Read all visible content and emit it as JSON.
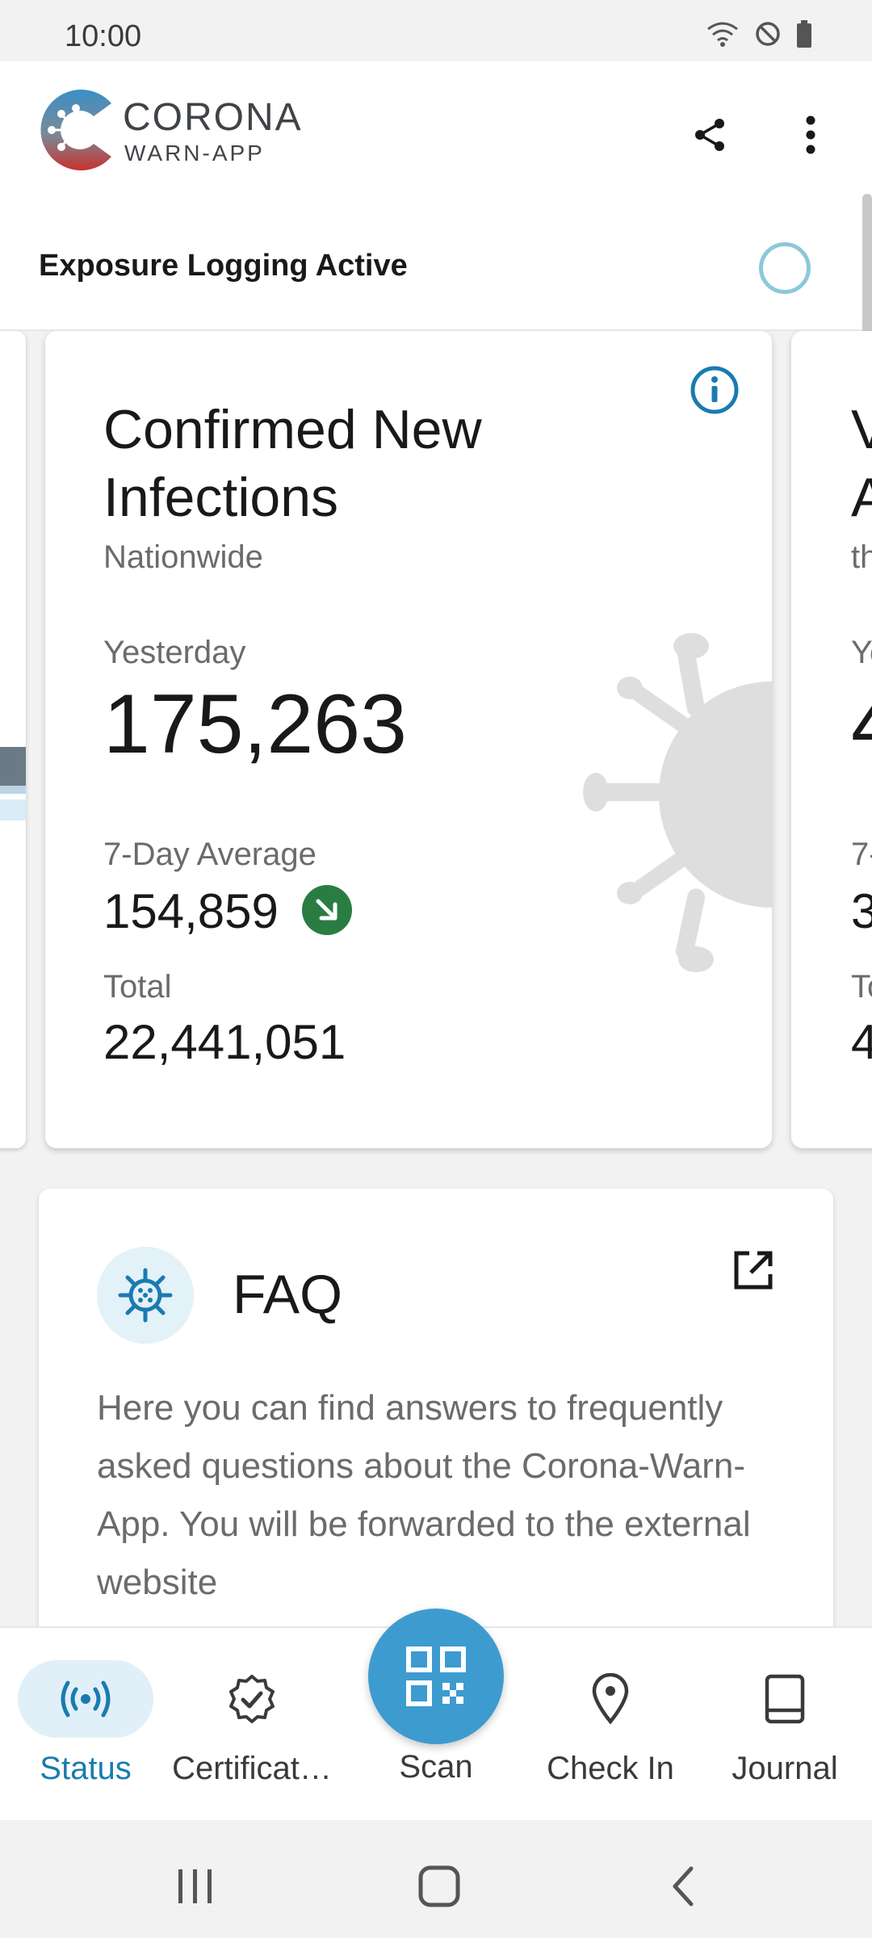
{
  "status_bar": {
    "time": "10:00"
  },
  "header": {
    "brand_line1": "CORONA",
    "brand_line2": "WARN-APP"
  },
  "exposure": {
    "label": "Exposure Logging Active"
  },
  "stat_card": {
    "title": "Confirmed New Infections",
    "subtitle": "Nationwide",
    "yesterday_label": "Yesterday",
    "yesterday_value": "175,263",
    "average_label": "7-Day Average",
    "average_value": "154,859",
    "trend": "down",
    "total_label": "Total",
    "total_value": "22,441,051"
  },
  "next_card_peek": {
    "title_line1": "V",
    "title_line2": "A",
    "subtitle": "th",
    "yesterday_label": "Ye",
    "yesterday_value": "4",
    "average_label": "7-",
    "average_value": "3",
    "total_label": "To",
    "total_value": "4"
  },
  "faq": {
    "title": "FAQ",
    "body": "Here you can find answers to frequently asked questions about the Corona-Warn-App. You will be forwarded to the external website"
  },
  "bottom_nav": {
    "items": [
      {
        "label": "Status",
        "active": true
      },
      {
        "label": "Certificat…",
        "active": false
      },
      {
        "label": "Scan",
        "active": false
      },
      {
        "label": "Check In",
        "active": false
      },
      {
        "label": "Journal",
        "active": false
      }
    ]
  },
  "colors": {
    "accent": "#1a7bb0",
    "fab": "#3e9bd0",
    "trend_down": "#2a7d42",
    "exposure_ring": "#8cc8da"
  }
}
